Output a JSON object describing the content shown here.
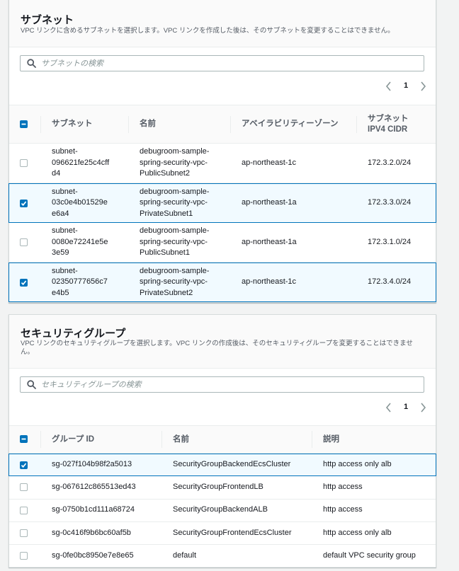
{
  "subnets": {
    "title": "サブネット",
    "description": "VPC リンクに含めるサブネットを選択します。VPC リンクを作成した後は、そのサブネットを変更することはできません。",
    "search_placeholder": "サブネットの検索",
    "page": "1",
    "columns": {
      "subnet": "サブネット",
      "name": "名前",
      "az": "アベイラビリティーゾーン",
      "cidr_line1": "サブネット",
      "cidr_line2": "IPV4 CIDR"
    },
    "rows": [
      {
        "selected": false,
        "subnet_id": [
          "subnet-",
          "096621fe25c4cff",
          "d4"
        ],
        "name": [
          "debugroom-sample-",
          "spring-security-vpc-",
          "PublicSubnet2"
        ],
        "az": "ap-northeast-1c",
        "cidr": "172.3.2.0/24"
      },
      {
        "selected": true,
        "subnet_id": [
          "subnet-",
          "03c0e4b01529e",
          "e6a4"
        ],
        "name": [
          "debugroom-sample-",
          "spring-security-vpc-",
          "PrivateSubnet1"
        ],
        "az": "ap-northeast-1a",
        "cidr": "172.3.3.0/24"
      },
      {
        "selected": false,
        "subnet_id": [
          "subnet-",
          "0080e72241e5e",
          "3e59"
        ],
        "name": [
          "debugroom-sample-",
          "spring-security-vpc-",
          "PublicSubnet1"
        ],
        "az": "ap-northeast-1a",
        "cidr": "172.3.1.0/24"
      },
      {
        "selected": true,
        "subnet_id": [
          "subnet-",
          "02350777656c7",
          "e4b5"
        ],
        "name": [
          "debugroom-sample-",
          "spring-security-vpc-",
          "PrivateSubnet2"
        ],
        "az": "ap-northeast-1c",
        "cidr": "172.3.4.0/24"
      }
    ]
  },
  "security_groups": {
    "title": "セキュリティグループ",
    "description": "VPC リンクのセキュリティグループを選択します。VPC リンクの作成後は、そのセキュリティグループを変更することはできません。",
    "search_placeholder": "セキュリティグループの検索",
    "page": "1",
    "columns": {
      "group_id": "グループ ID",
      "name": "名前",
      "description": "説明"
    },
    "rows": [
      {
        "selected": true,
        "group_id": "sg-027f104b98f2a5013",
        "name": "SecurityGroupBackendEcsCluster",
        "description": "http access only alb"
      },
      {
        "selected": false,
        "group_id": "sg-067612c865513ed43",
        "name": "SecurityGroupFrontendLB",
        "description": "http access"
      },
      {
        "selected": false,
        "group_id": "sg-0750b1cd111a68724",
        "name": "SecurityGroupBackendALB",
        "description": "http access"
      },
      {
        "selected": false,
        "group_id": "sg-0c416f9b6bc60af5b",
        "name": "SecurityGroupFrontendEcsCluster",
        "description": "http access only alb"
      },
      {
        "selected": false,
        "group_id": "sg-0fe0bc8950e7e8e65",
        "name": "default",
        "description": "default VPC security group"
      }
    ]
  },
  "colors": {
    "accent": "#0073bb",
    "selected_row_bg": "#f1faff",
    "border": "#eaeded"
  }
}
